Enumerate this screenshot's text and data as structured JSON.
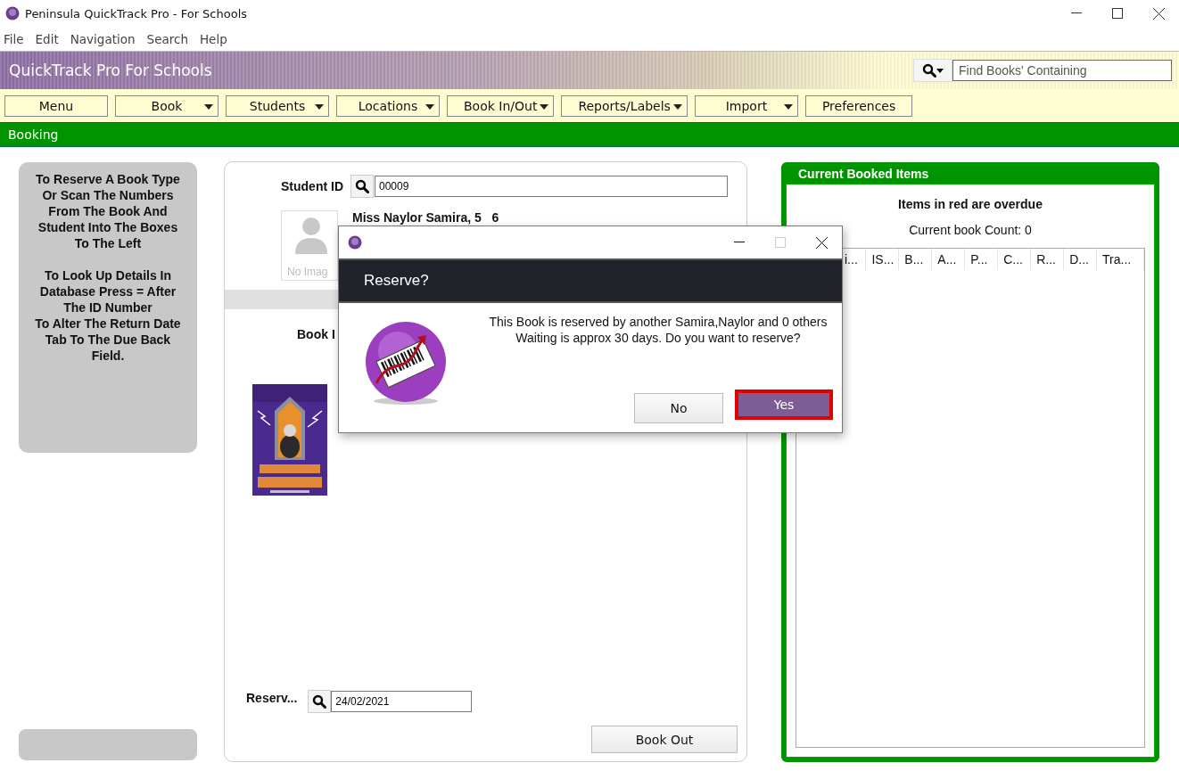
{
  "window": {
    "title": "Peninsula QuickTrack Pro - For Schools"
  },
  "menu_bar": [
    "File",
    "Edit",
    "Navigation",
    "Search",
    "Help"
  ],
  "banner": {
    "title": "QuickTrack Pro For Schools",
    "search": {
      "placeholder": "Find Books' Containing"
    }
  },
  "toolbar": [
    {
      "label": "Menu",
      "dropdown": false
    },
    {
      "label": "Book",
      "dropdown": true
    },
    {
      "label": "Students",
      "dropdown": true
    },
    {
      "label": "Locations",
      "dropdown": true
    },
    {
      "label": "Book In/Out",
      "dropdown": true
    },
    {
      "label": "Reports/Labels",
      "dropdown": true
    },
    {
      "label": "Import",
      "dropdown": true
    },
    {
      "label": "Preferences",
      "dropdown": false
    }
  ],
  "section_bar": {
    "title": "Booking"
  },
  "help_panel": {
    "paragraphs": [
      "To Reserve A Book Type Or Scan The Numbers From The Book And Student Into The Boxes To The Left",
      "To Look Up Details In Database Press = After The ID Number",
      "To Alter The Return Date Tab To The Due Back Field."
    ]
  },
  "booking_form": {
    "student_id": {
      "label": "Student ID",
      "value": "00009"
    },
    "student_name": "Miss Naylor Samira, 5   6",
    "photo_placeholder": "No Imag",
    "book_id_label": "Book I",
    "reserve": {
      "label": "Reserv...",
      "value": "24/02/2021"
    },
    "book_out_button": "Book Out"
  },
  "booked_items": {
    "title": "Current Booked Items",
    "note": "Items in red are overdue",
    "count": "Current book Count: 0",
    "columns": [
      "i...",
      "IS...",
      "B...",
      "A...",
      "P...",
      "C...",
      "R...",
      "D...",
      "Tra..."
    ]
  },
  "dialog": {
    "heading": "Reserve?",
    "message": [
      "This Book is reserved by another Samira,Naylor and 0 others",
      "Waiting is approx 30 days. Do you want to reserve?"
    ],
    "buttons": [
      {
        "label": "No",
        "default": false
      },
      {
        "label": "Yes",
        "default": true
      }
    ]
  }
}
